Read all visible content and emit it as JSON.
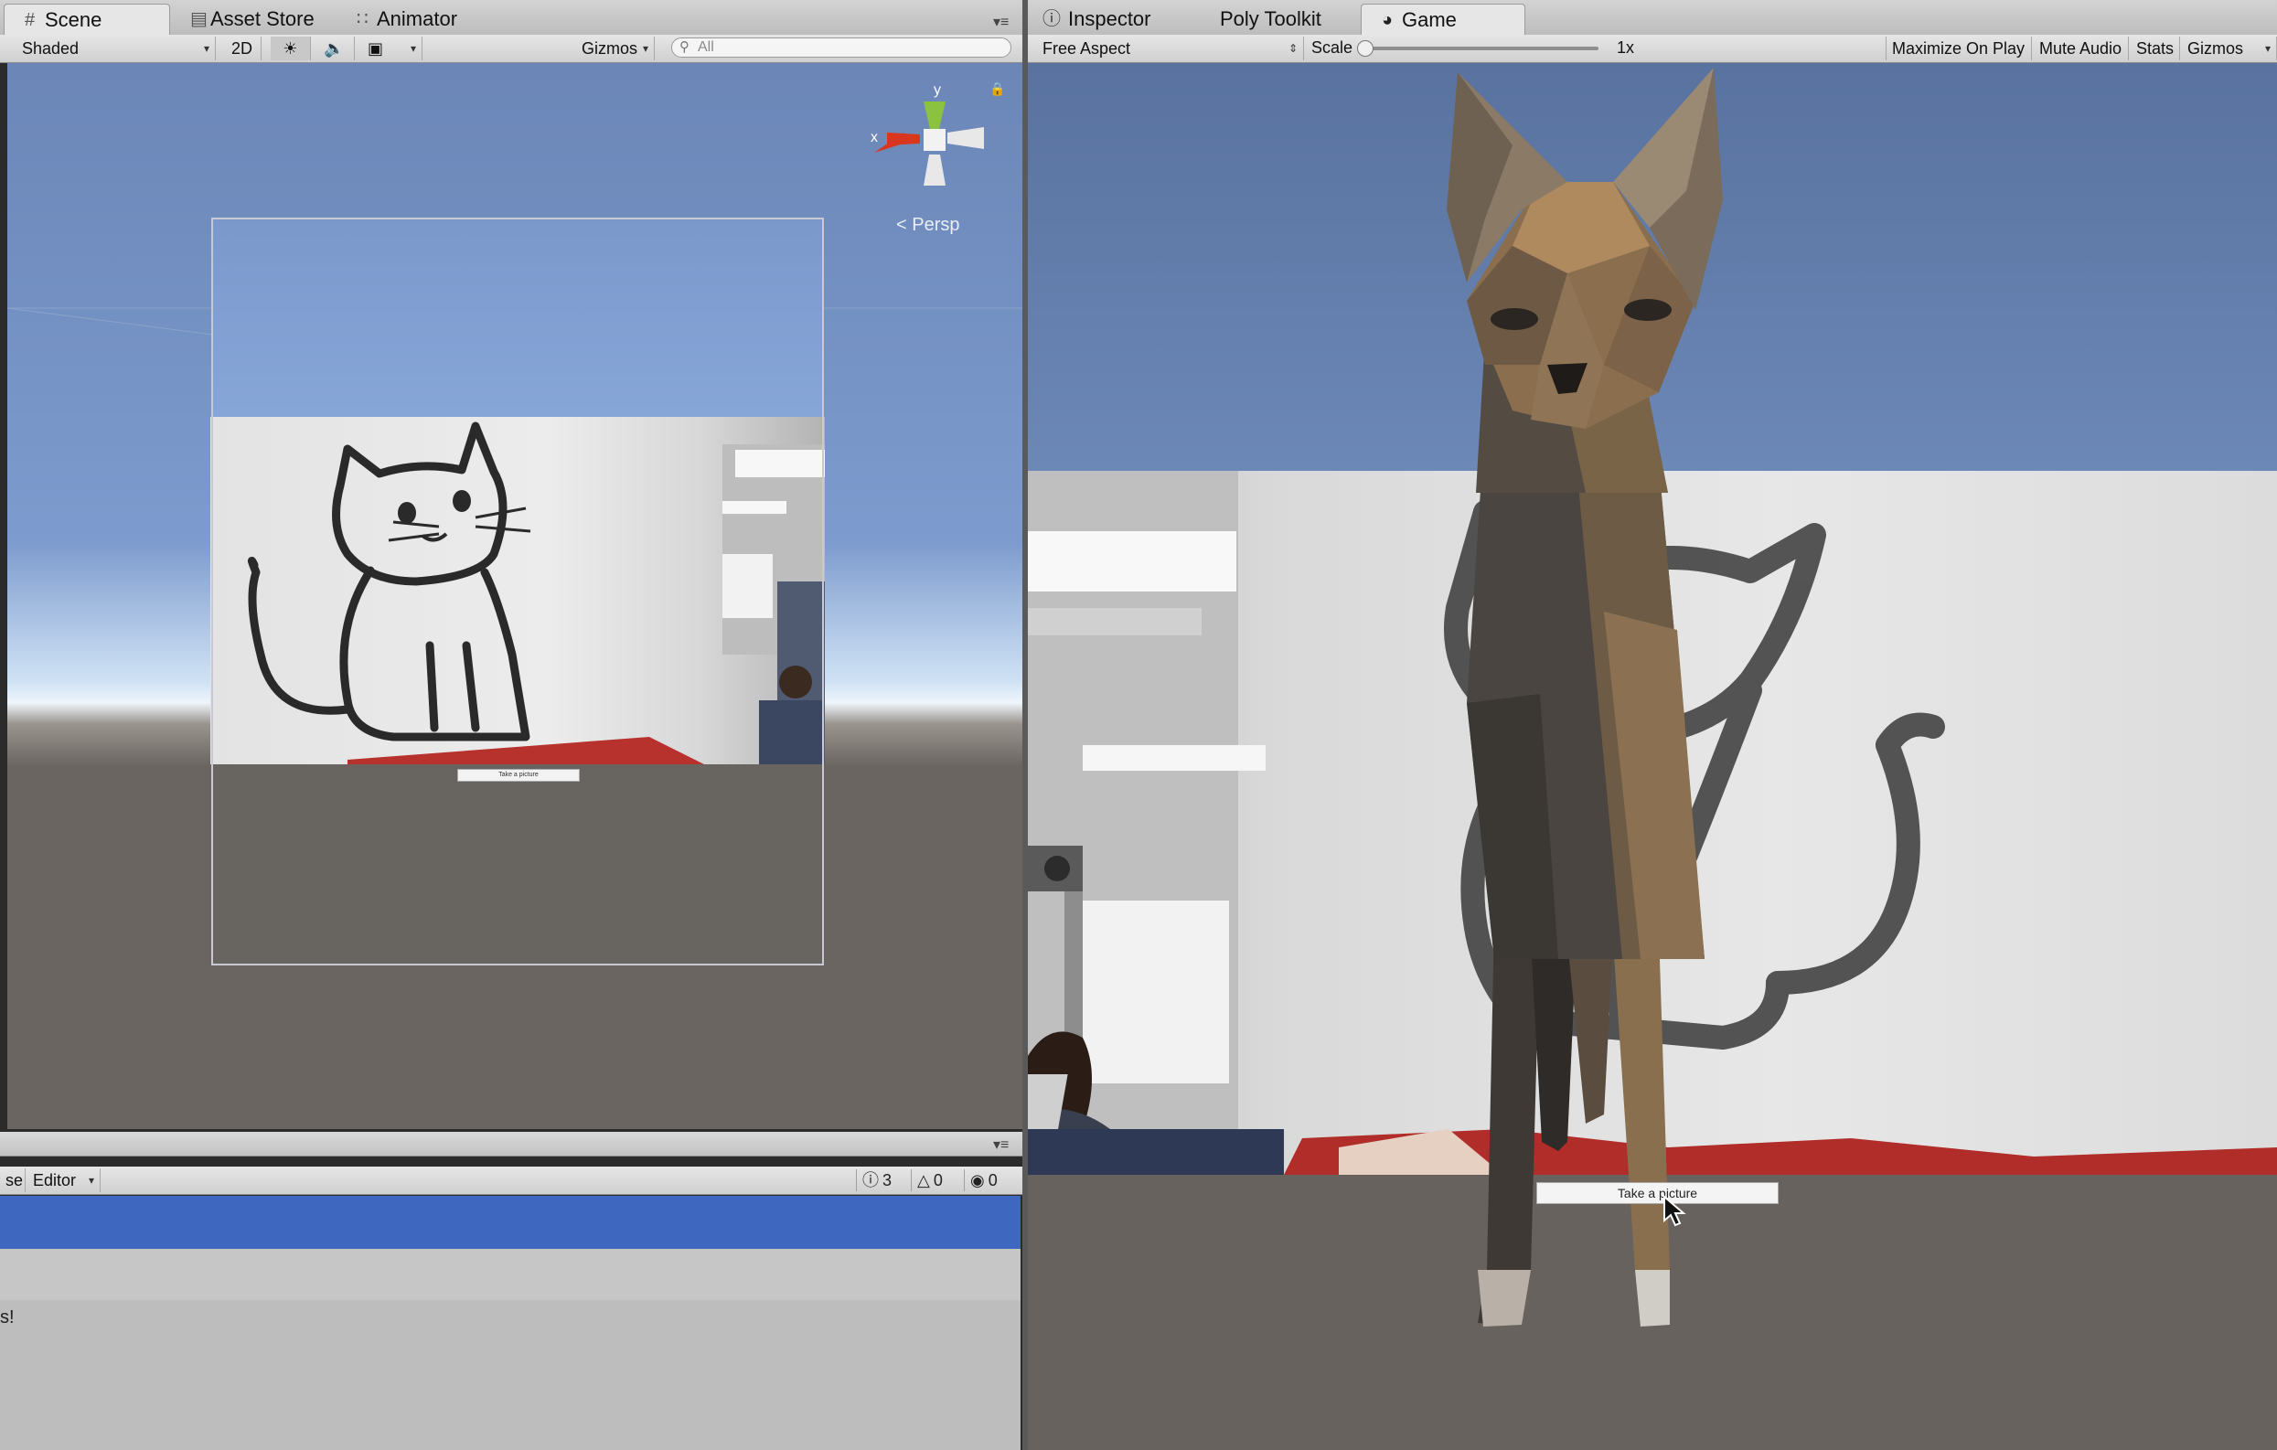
{
  "left_tabs": [
    {
      "label": "Scene",
      "icon": "grid-icon",
      "active": true
    },
    {
      "label": "Asset Store",
      "icon": "bag-icon",
      "active": false
    },
    {
      "label": "Animator",
      "icon": "animator-icon",
      "active": false
    }
  ],
  "right_tabs": [
    {
      "label": "Inspector",
      "icon": "info-icon",
      "active": false
    },
    {
      "label": "Poly Toolkit",
      "icon": "",
      "active": false
    },
    {
      "label": "Game",
      "icon": "pacman-icon",
      "active": true
    }
  ],
  "scene_toolbar": {
    "draw_mode": "Shaded",
    "mode_2d": "2D",
    "gizmos": "Gizmos",
    "search_placeholder": "All"
  },
  "scene_view": {
    "projection_label": "< Persp",
    "axis_x": "x",
    "axis_y": "y",
    "camera_ui_button": "Take a picture"
  },
  "game_toolbar": {
    "aspect": "Free Aspect",
    "scale_label": "Scale",
    "scale_value": "1x",
    "scale_level": 0.0,
    "maximize_on_play": "Maximize On Play",
    "mute_audio": "Mute Audio",
    "stats": "Stats",
    "gizmos": "Gizmos"
  },
  "game_view": {
    "take_picture_button": "Take a picture"
  },
  "console": {
    "clear_on_play_fragment": "se",
    "editor_dropdown": "Editor",
    "log_count": "3",
    "warning_count": "0",
    "error_count": "0",
    "message_fragment": "s!"
  },
  "colors": {
    "selection_blue": "#3e67c0",
    "axis_x_red": "#d9361f",
    "axis_y_green": "#8bc340"
  }
}
